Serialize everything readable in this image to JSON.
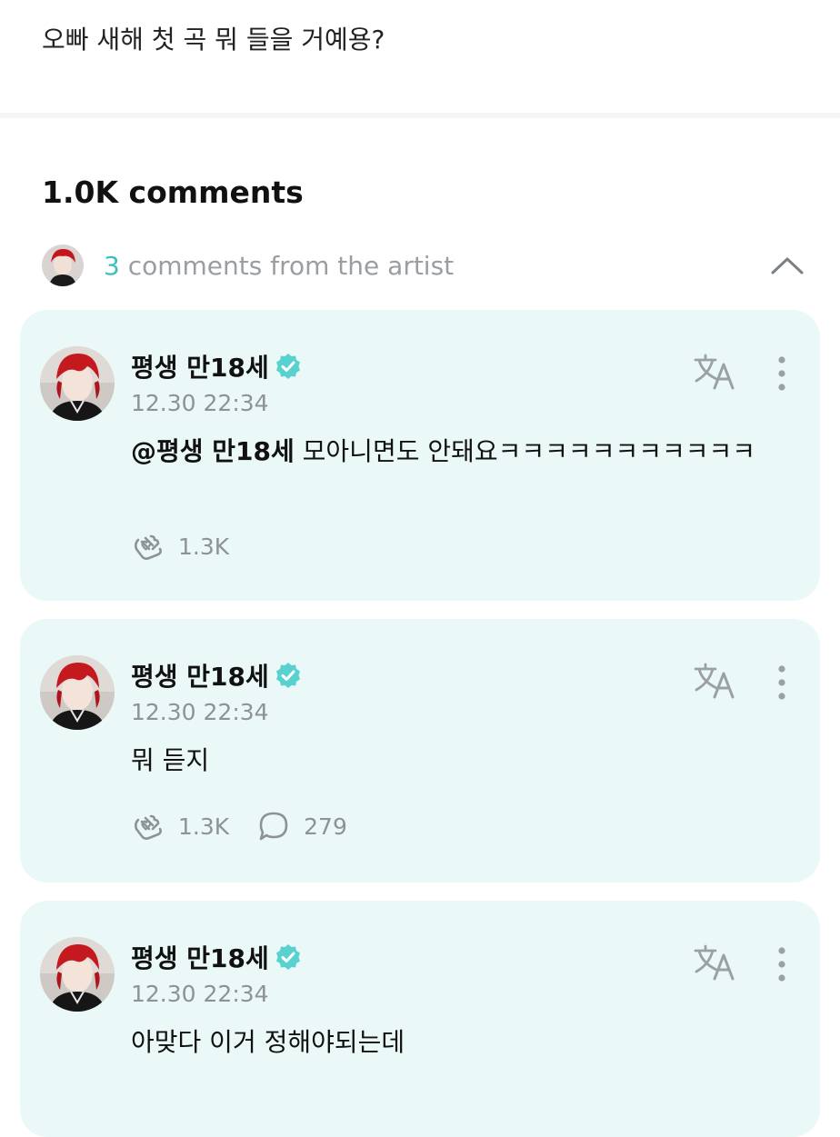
{
  "post": {
    "text": "오빠 새해 첫 곡 뭐 들을 거예용?"
  },
  "comments_header": {
    "count_label": "1.0K comments"
  },
  "artist_summary": {
    "count": "3",
    "label": "comments from the artist"
  },
  "colors": {
    "accent": "#3dbfbf",
    "card_bg": "#eaf9f7",
    "muted": "#8e9296",
    "verified": "#5ad1d1"
  },
  "comments": [
    {
      "author": "평생 만18세",
      "timestamp": "12.30 22:34",
      "mention": "@평생 만18세",
      "text": " 모아니면도 안돼요ㅋㅋㅋㅋㅋㅋㅋㅋㅋㅋㅋ",
      "likes": "1.3K",
      "replies": ""
    },
    {
      "author": "평생 만18세",
      "timestamp": "12.30 22:34",
      "mention": "",
      "text": "뭐 듣지",
      "likes": "1.3K",
      "replies": "279"
    },
    {
      "author": "평생 만18세",
      "timestamp": "12.30 22:34",
      "mention": "",
      "text": "아맞다 이거 정해야되는데",
      "likes": "",
      "replies": ""
    }
  ],
  "icons": {
    "translate": "translate-icon",
    "more": "more-vertical-icon",
    "like": "heart-hands-icon",
    "reply": "speech-bubble-icon",
    "verified": "verified-badge-icon",
    "collapse": "chevron-up-icon"
  }
}
